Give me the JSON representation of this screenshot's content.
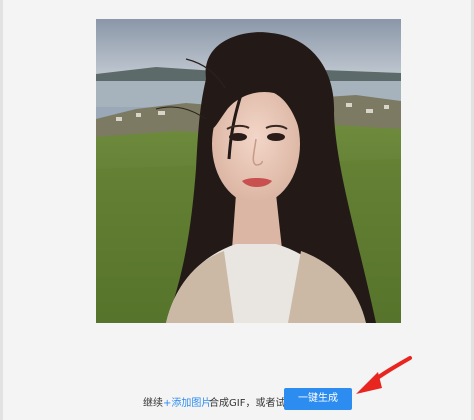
{
  "continue_text": "继续",
  "add_image_link": "+添加图片",
  "compose_text": "合成GIF，或者试试",
  "generate_button": "一键生成",
  "colors": {
    "accent": "#2d8cf0",
    "arrow": "#e8251f",
    "background": "#f4f4f4"
  },
  "icons": {
    "pointer": "red-arrow-icon"
  }
}
